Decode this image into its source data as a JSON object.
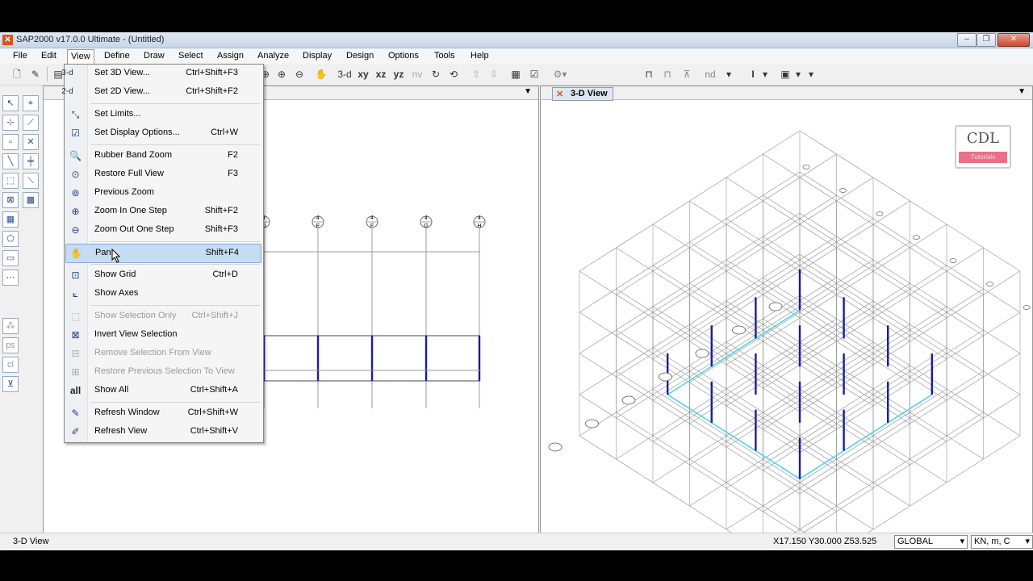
{
  "window": {
    "title": "SAP2000 v17.0.0 Ultimate  - (Untitled)",
    "minimize": "–",
    "restore": "❐",
    "close": "✕"
  },
  "menubar": {
    "items": [
      "File",
      "Edit",
      "View",
      "Define",
      "Draw",
      "Select",
      "Assign",
      "Analyze",
      "Display",
      "Design",
      "Options",
      "Tools",
      "Help"
    ]
  },
  "toolbar": {
    "items": [
      "3-d",
      "xy",
      "xz",
      "yz",
      "nv",
      "nd",
      "I"
    ]
  },
  "view_menu": {
    "items": [
      {
        "label": "Set 3D View...",
        "shortcut": "Ctrl+Shift+F3",
        "icon": "3-d",
        "enabled": true
      },
      {
        "label": "Set 2D View...",
        "shortcut": "Ctrl+Shift+F2",
        "icon": "2-d",
        "enabled": true
      },
      {
        "label": "Set Limits...",
        "shortcut": "",
        "icon": "limits-icon",
        "enabled": true
      },
      {
        "label": "Set Display Options...",
        "shortcut": "Ctrl+W",
        "icon": "checkbox-icon",
        "enabled": true
      },
      {
        "label": "Rubber Band Zoom",
        "shortcut": "F2",
        "icon": "zoom-icon",
        "enabled": true
      },
      {
        "label": "Restore Full View",
        "shortcut": "F3",
        "icon": "zoom-full-icon",
        "enabled": true
      },
      {
        "label": "Previous Zoom",
        "shortcut": "",
        "icon": "zoom-previous-icon",
        "enabled": true
      },
      {
        "label": "Zoom In One Step",
        "shortcut": "Shift+F2",
        "icon": "zoom-in-icon",
        "enabled": true
      },
      {
        "label": "Zoom Out One Step",
        "shortcut": "Shift+F3",
        "icon": "zoom-out-icon",
        "enabled": true
      },
      {
        "label": "Pan",
        "shortcut": "Shift+F4",
        "icon": "hand-icon",
        "enabled": true,
        "highlighted": true
      },
      {
        "label": "Show Grid",
        "shortcut": "Ctrl+D",
        "icon": "grid-icon",
        "enabled": true
      },
      {
        "label": "Show Axes",
        "shortcut": "",
        "icon": "axes-icon",
        "enabled": true
      },
      {
        "label": "Show Selection Only",
        "shortcut": "Ctrl+Shift+J",
        "icon": "selection-only-icon",
        "enabled": false
      },
      {
        "label": "Invert View Selection",
        "shortcut": "",
        "icon": "invert-icon",
        "enabled": true
      },
      {
        "label": "Remove Selection From View",
        "shortcut": "",
        "icon": "remove-selection-icon",
        "enabled": false
      },
      {
        "label": "Restore Previous Selection To View",
        "shortcut": "",
        "icon": "restore-selection-icon",
        "enabled": false
      },
      {
        "label": "Show All",
        "shortcut": "Ctrl+Shift+A",
        "icon": "all",
        "enabled": true
      },
      {
        "label": "Refresh Window",
        "shortcut": "Ctrl+Shift+W",
        "icon": "pencil-icon",
        "enabled": true
      },
      {
        "label": "Refresh View",
        "shortcut": "Ctrl+Shift+V",
        "icon": "pencil-check-icon",
        "enabled": true
      }
    ]
  },
  "left_pane": {
    "grid_labels": [
      "4\nD",
      "4\nE",
      "4\nF",
      "4\nG",
      "4\nH"
    ]
  },
  "right_pane": {
    "tab_label": "3-D View",
    "watermark": "CDL",
    "watermark_sub": "Tutorials"
  },
  "statusbar": {
    "view_name": "3-D View",
    "coordinates": "X17.150  Y30.000  Z53.525",
    "coord_system": "GLOBAL",
    "units": "KN, m, C"
  },
  "colors": {
    "column": "#1a1aa8",
    "selected_beam": "#4fd4e6",
    "grid": "#9a9a9a",
    "menu_highlight": "#c6dcf3"
  }
}
